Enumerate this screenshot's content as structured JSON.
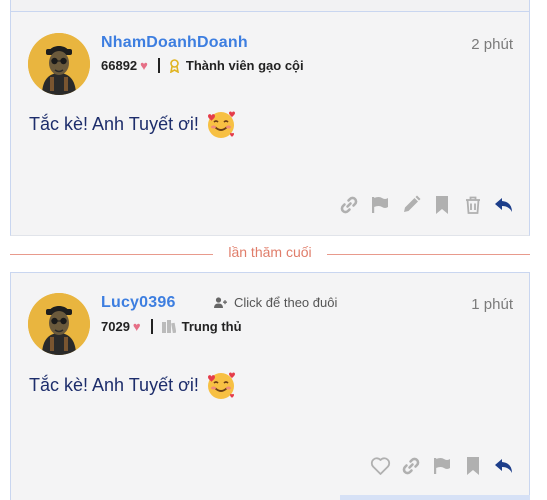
{
  "posts": [
    {
      "username": "NhamDoanhDoanh",
      "time": "2 phút",
      "likes": "66892",
      "badge": "Thành viên gạo cội",
      "content": "Tắc kè! Anh Tuyết ơi!",
      "actions": [
        "link-icon",
        "flag-icon",
        "pencil-icon",
        "bookmark-icon",
        "trash-icon",
        "reply-icon"
      ]
    },
    {
      "username": "Lucy0396",
      "time": "1 phút",
      "likes": "7029",
      "badge": "Trung thủ",
      "follow": "Click để theo đuôi",
      "content": "Tắc kè! Anh Tuyết ơi!",
      "actions": [
        "heart-outline-icon",
        "link-icon",
        "flag-icon",
        "bookmark-icon",
        "reply-icon"
      ]
    }
  ],
  "divider": {
    "label": "lần thăm cuối"
  },
  "colors": {
    "accent": "#3d7ee0",
    "divider": "#e89a8c",
    "reply": "#1d3e8a",
    "icon": "#b0b0b0"
  }
}
